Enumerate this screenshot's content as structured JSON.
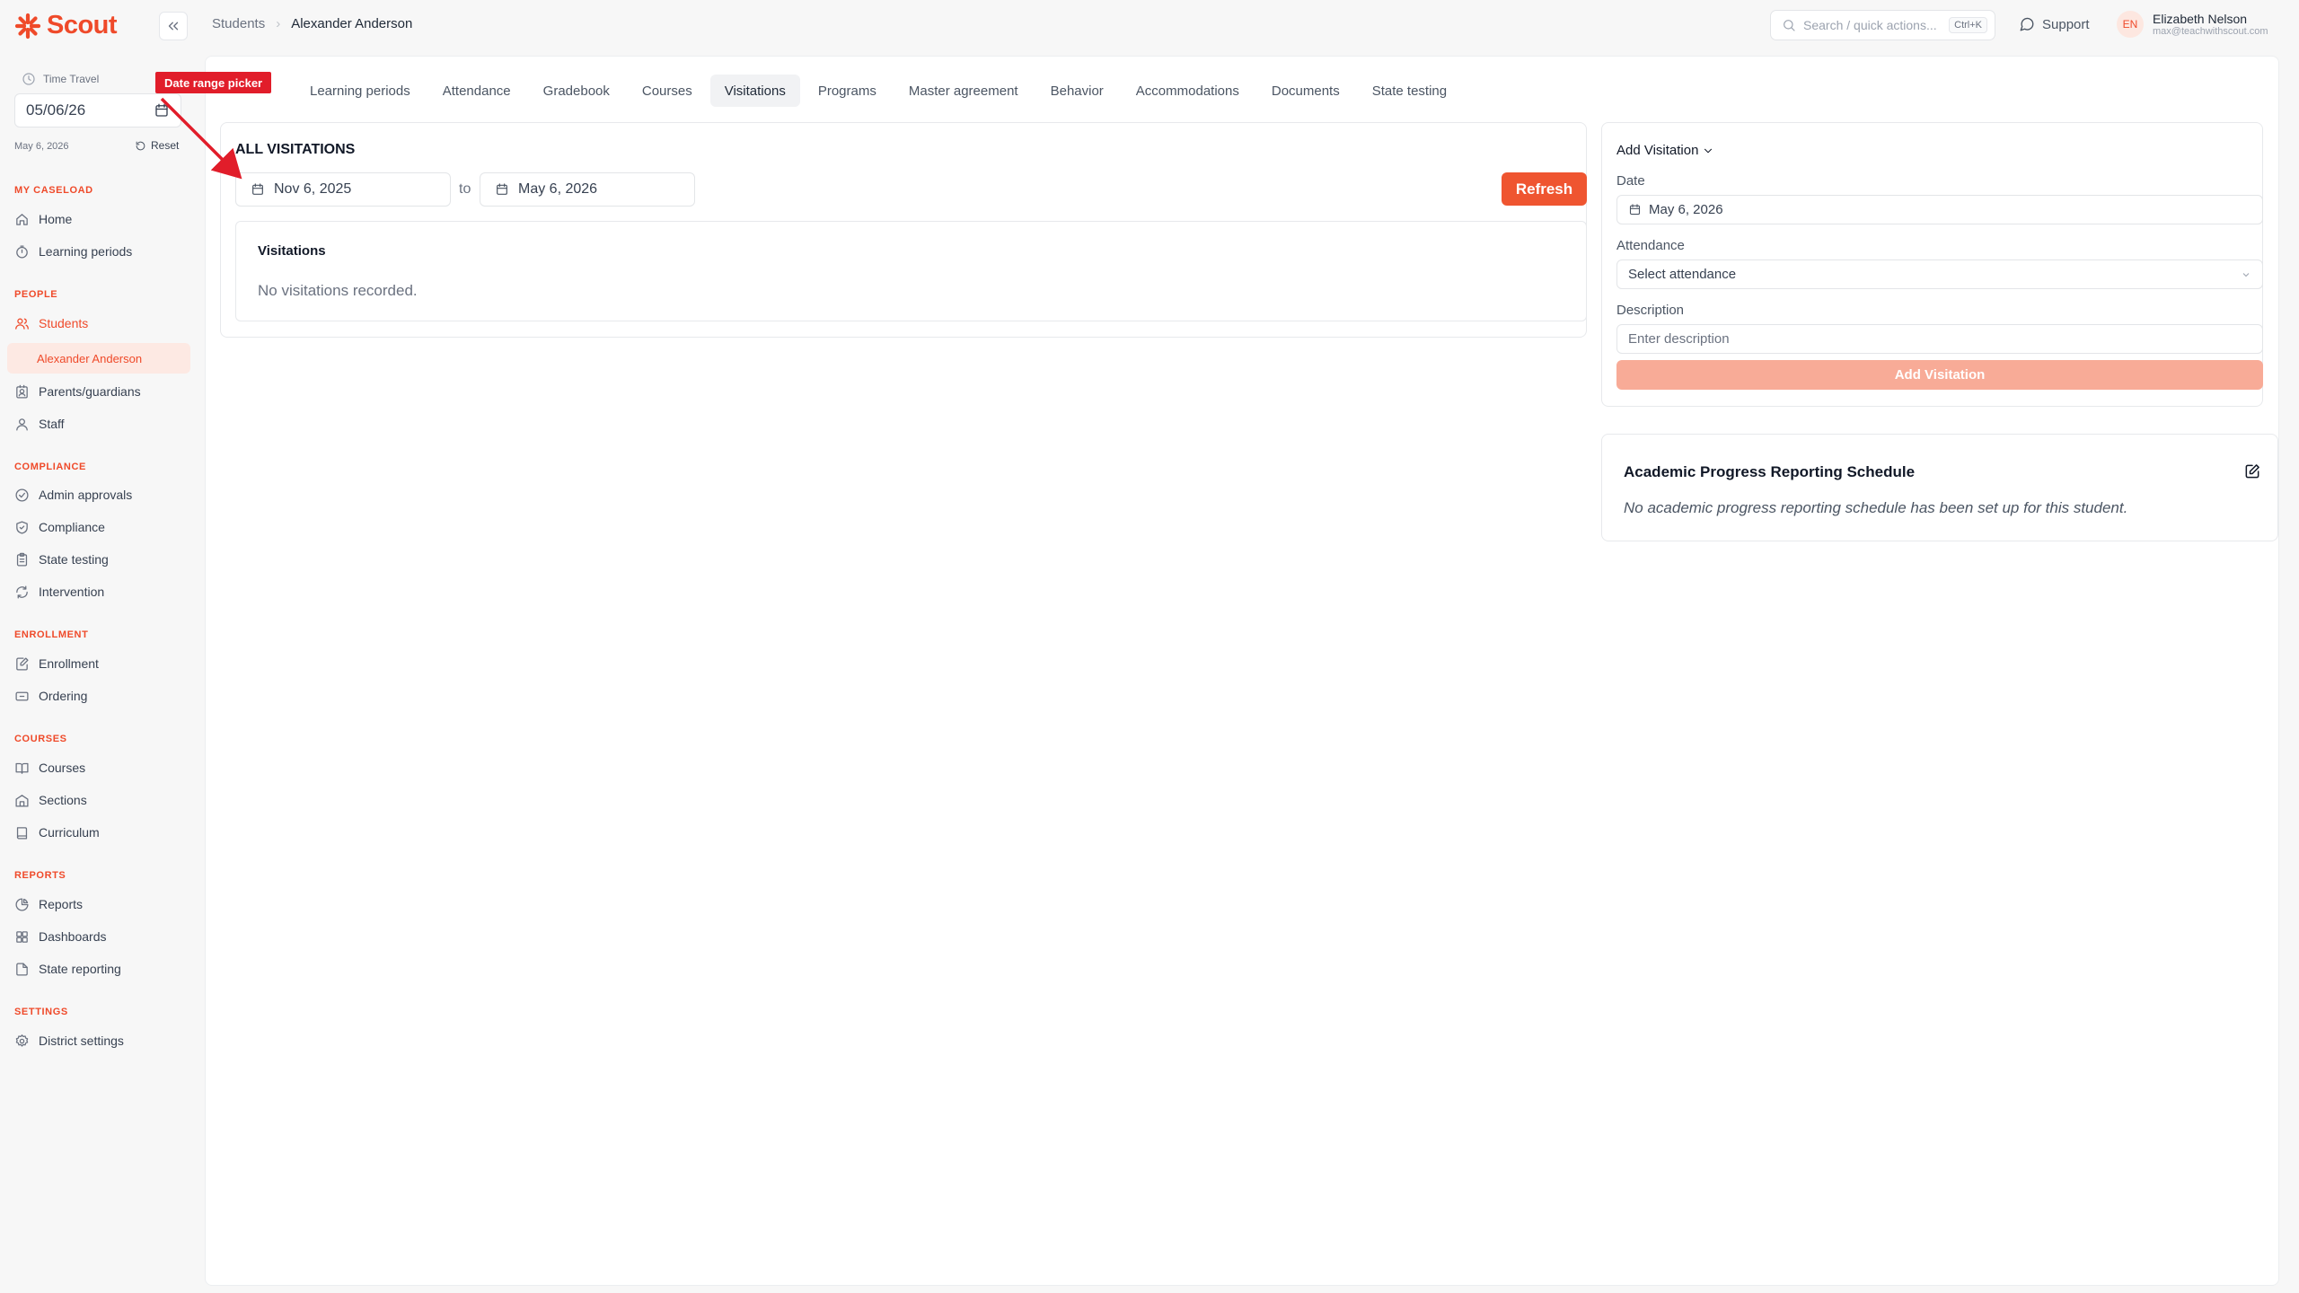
{
  "app": {
    "name": "Scout"
  },
  "breadcrumb": {
    "parent": "Students",
    "current": "Alexander Anderson"
  },
  "search": {
    "placeholder": "Search / quick actions...",
    "shortcut": "Ctrl+K"
  },
  "support": {
    "label": "Support"
  },
  "user": {
    "initials": "EN",
    "name": "Elizabeth Nelson",
    "email": "max@teachwithscout.com"
  },
  "time_travel": {
    "label": "Time Travel",
    "value": "05/06/26",
    "current_date": "May 6, 2026",
    "reset_label": "Reset"
  },
  "annotation": {
    "label": "Date range picker",
    "color": "#e11d2a"
  },
  "sidebar": {
    "sections": {
      "caseload": "MY CASELOAD",
      "people": "PEOPLE",
      "compliance": "COMPLIANCE",
      "enrollment": "ENROLLMENT",
      "courses": "COURSES",
      "reports": "REPORTS",
      "settings": "SETTINGS"
    },
    "items": {
      "home": "Home",
      "learning_periods": "Learning periods",
      "students": "Students",
      "student_sub": "Alexander Anderson",
      "parents": "Parents/guardians",
      "staff": "Staff",
      "admin_approvals": "Admin approvals",
      "compliance": "Compliance",
      "state_testing": "State testing",
      "intervention": "Intervention",
      "enrollment": "Enrollment",
      "ordering": "Ordering",
      "courses": "Courses",
      "sections": "Sections",
      "curriculum": "Curriculum",
      "reports": "Reports",
      "dashboards": "Dashboards",
      "state_reporting": "State reporting",
      "district_settings": "District settings"
    }
  },
  "tabs": [
    {
      "label": ""
    },
    {
      "label": "Learning periods"
    },
    {
      "label": "Attendance"
    },
    {
      "label": "Gradebook"
    },
    {
      "label": "Courses"
    },
    {
      "label": "Visitations",
      "active": true
    },
    {
      "label": "Programs"
    },
    {
      "label": "Master agreement"
    },
    {
      "label": "Behavior"
    },
    {
      "label": "Accommodations"
    },
    {
      "label": "Documents"
    },
    {
      "label": "State testing"
    }
  ],
  "visitations": {
    "title": "ALL VISITATIONS",
    "start_date": "Nov 6, 2025",
    "to_label": "to",
    "end_date": "May 6, 2026",
    "refresh_label": "Refresh",
    "list_title": "Visitations",
    "empty_text": "No visitations recorded."
  },
  "add_visitation": {
    "title": "Add Visitation",
    "date_label": "Date",
    "date_value": "May 6, 2026",
    "attendance_label": "Attendance",
    "attendance_placeholder": "Select attendance",
    "description_label": "Description",
    "description_placeholder": "Enter description",
    "submit_label": "Add Visitation"
  },
  "progress_schedule": {
    "title": "Academic Progress Reporting Schedule",
    "empty_text": "No academic progress reporting schedule has been set up for this student."
  },
  "colors": {
    "accent": "#ef4a2a",
    "button": "#ef5530",
    "button_disabled": "#f8ab97"
  }
}
